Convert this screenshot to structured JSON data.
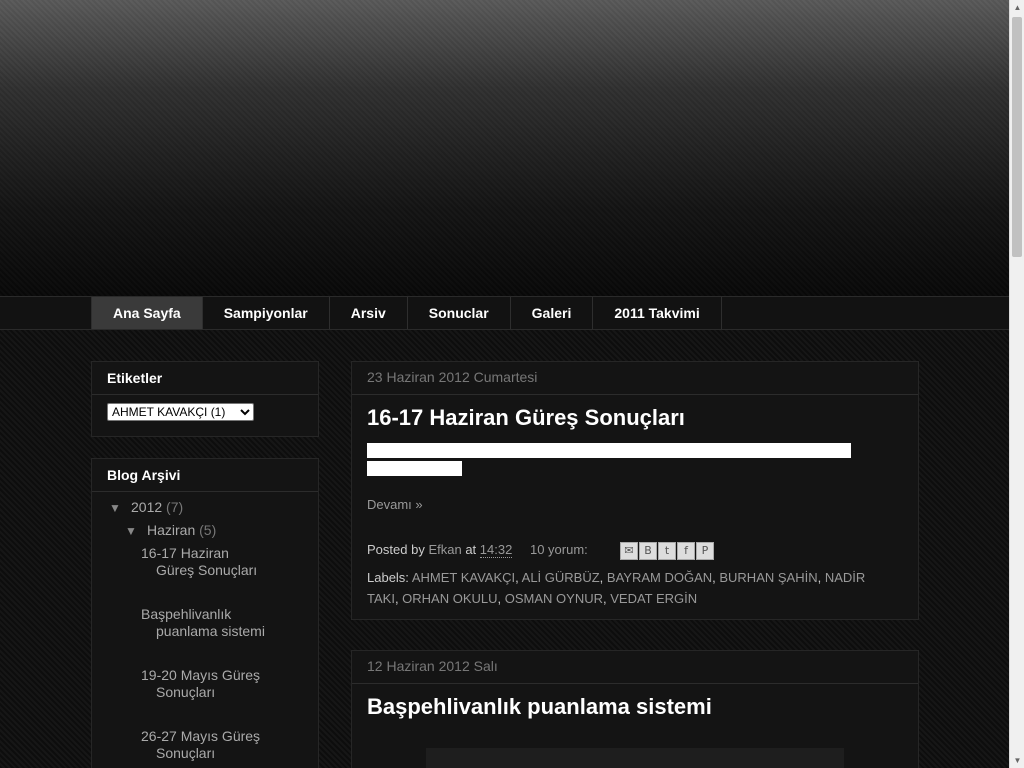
{
  "nav": {
    "tabs": [
      "Ana Sayfa",
      "Sampiyonlar",
      "Arsiv",
      "Sonuclar",
      "Galeri",
      "2011 Takvimi"
    ]
  },
  "sidebar": {
    "labels_widget": {
      "title": "Etiketler",
      "selected_option": "AHMET KAVAKÇI (1)"
    },
    "archive_widget": {
      "title": "Blog Arşivi",
      "year": {
        "toggle": "▼",
        "label": "2012",
        "count": "(7)"
      },
      "month": {
        "toggle": "▼",
        "label": "Haziran",
        "count": "(5)"
      },
      "posts": [
        "16-17 Haziran Güreş Sonuçları",
        "Başpehlivanlık puanlama sistemi",
        "19-20 Mayıs Güreş Sonuçları",
        "26-27 Mayıs Güreş Sonuçları"
      ]
    }
  },
  "posts": [
    {
      "date": "23 Haziran 2012 Cumartesi",
      "title": "16-17 Haziran Güreş Sonuçları",
      "more": "Devamı »",
      "posted_by_label": "Posted by",
      "author": "Efkan",
      "at_label": "at",
      "time": "14:32",
      "comments": "10 yorum:",
      "labels_prefix": "Labels:",
      "labels": [
        "AHMET KAVAKÇI",
        "ALİ GÜRBÜZ",
        "BAYRAM DOĞAN",
        "BURHAN ŞAHİN",
        "NADİR TAKI",
        "ORHAN OKULU",
        "OSMAN OYNUR",
        "VEDAT ERGİN"
      ]
    },
    {
      "date": "12 Haziran 2012 Salı",
      "title": "Başpehlivanlık puanlama sistemi"
    }
  ],
  "share_icons": [
    "email-icon",
    "blogger-icon",
    "twitter-icon",
    "facebook-icon",
    "pinterest-icon"
  ]
}
